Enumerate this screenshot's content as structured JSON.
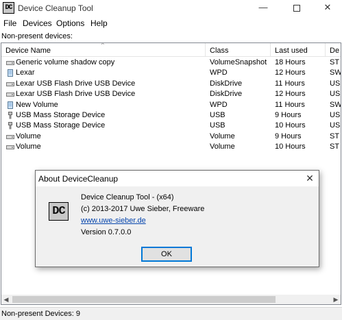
{
  "window": {
    "title": "Device Cleanup Tool",
    "icon_text": "DC",
    "minimize_glyph": "—",
    "close_glyph": "✕"
  },
  "menu": [
    "File",
    "Devices",
    "Options",
    "Help"
  ],
  "section_label": "Non-present devices:",
  "columns": [
    "Device Name",
    "Class",
    "Last used",
    "De"
  ],
  "sort_indicator": "^",
  "rows": [
    {
      "name": "Generic volume shadow copy",
      "class": "VolumeSnapshot",
      "last_used": "18 Hours",
      "desc": "ST",
      "icon": "drive-icon"
    },
    {
      "name": "Lexar",
      "class": "WPD",
      "last_used": "12 Hours",
      "desc": "SW",
      "icon": "portable-device-icon"
    },
    {
      "name": "Lexar USB Flash Drive USB Device",
      "class": "DiskDrive",
      "last_used": "11 Hours",
      "desc": "US",
      "icon": "drive-icon"
    },
    {
      "name": "Lexar USB Flash Drive USB Device",
      "class": "DiskDrive",
      "last_used": "12 Hours",
      "desc": "US",
      "icon": "drive-icon"
    },
    {
      "name": "New Volume",
      "class": "WPD",
      "last_used": "11 Hours",
      "desc": "SW",
      "icon": "portable-device-icon"
    },
    {
      "name": "USB Mass Storage Device",
      "class": "USB",
      "last_used": "9 Hours",
      "desc": "US",
      "icon": "usb-plug-icon"
    },
    {
      "name": "USB Mass Storage Device",
      "class": "USB",
      "last_used": "10 Hours",
      "desc": "US",
      "icon": "usb-plug-icon"
    },
    {
      "name": "Volume",
      "class": "Volume",
      "last_used": "9 Hours",
      "desc": "ST",
      "icon": "drive-icon"
    },
    {
      "name": "Volume",
      "class": "Volume",
      "last_used": "10 Hours",
      "desc": "ST",
      "icon": "drive-icon"
    }
  ],
  "status": "Non-present Devices: 9",
  "dialog": {
    "title": "About DeviceCleanup",
    "close_glyph": "✕",
    "logo_text": "DC",
    "line1": "Device Cleanup Tool - (x64)",
    "line2": "(c) 2013-2017 Uwe Sieber, Freeware",
    "link": "www.uwe-sieber.de",
    "version": "Version 0.7.0.0",
    "ok_label": "OK"
  },
  "colors": {
    "accent": "#0078d7",
    "link": "#0645ad",
    "dialog_body": "#f0f0f0"
  }
}
